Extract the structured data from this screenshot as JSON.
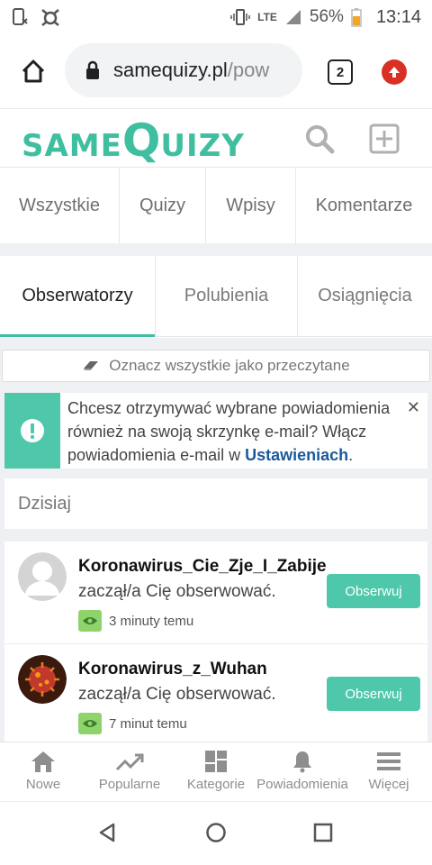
{
  "status_bar": {
    "battery": "56%",
    "time": "13:14",
    "network": "LTE"
  },
  "browser": {
    "url_domain": "samequizy.pl",
    "url_path": "/pow",
    "tab_count": "2"
  },
  "site": {
    "logo_same": "SAME",
    "logo_q": "Q",
    "logo_uizy": "UIZY",
    "accent_color": "#3fbfa0"
  },
  "category_tabs": [
    "Wszystkie",
    "Quizy",
    "Wpisy",
    "Komentarze"
  ],
  "notif_tabs": [
    "Obserwatorzy",
    "Polubienia",
    "Osiągnięcia"
  ],
  "mark_all_read": "Oznacz wszystkie jako przeczytane",
  "email_banner": {
    "text": "Chcesz otrzymywać wybrane powiadomienia również na swoją skrzynkę e-mail? Włącz powiadomienia e-mail w ",
    "link": "Ustawieniach",
    "end": "."
  },
  "day_header": "Dzisiaj",
  "notifications": [
    {
      "user": "Koronawirus_Cie_Zje_I_Zabije",
      "action": " zaczął/a Cię obserwować.",
      "time": "3 minuty temu",
      "button": "Obserwuj"
    },
    {
      "user": "Koronawirus_z_Wuhan",
      "action": "zaczął/a Cię obserwować.",
      "time": "7 minut temu",
      "button": "Obserwuj"
    }
  ],
  "bottom_nav": [
    "Nowe",
    "Popularne",
    "Kategorie",
    "Powiadomienia",
    "Więcej"
  ]
}
